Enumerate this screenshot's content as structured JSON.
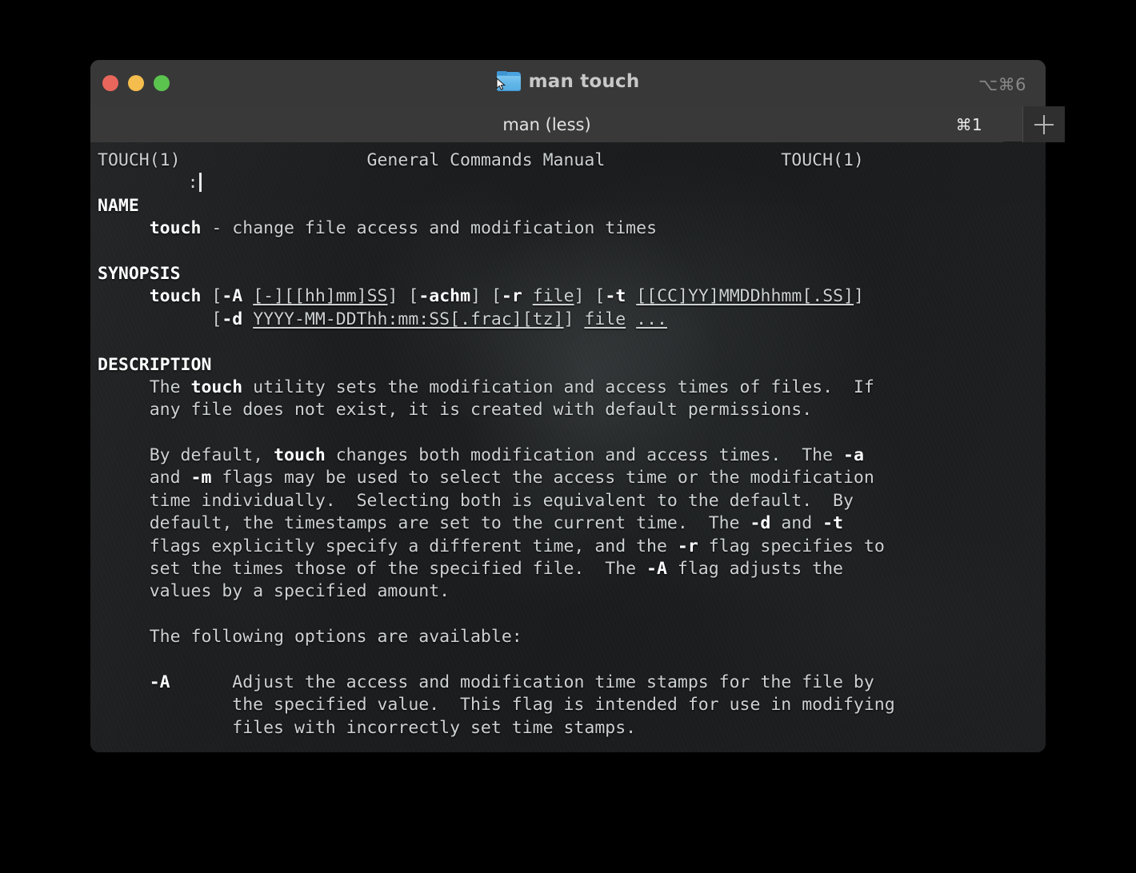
{
  "window": {
    "title": "man touch",
    "title_shortcut": "⌥⌘6",
    "folder_icon": "folder-icon",
    "traffic_lights": {
      "close": "close-button",
      "minimize": "minimize-button",
      "zoom": "zoom-button",
      "close_color": "#e8665c",
      "minimize_color": "#f4bd4d",
      "zoom_color": "#5bc44e"
    }
  },
  "tabbar": {
    "tab_label": "man (less)",
    "tab_shortcut": "⌘1",
    "new_tab_icon": "plus-icon"
  },
  "terminal": {
    "prompt": ":",
    "lines": [
      {
        "id": "l01",
        "segments": [
          {
            "t": "TOUCH(1)                  General Commands Manual                 TOUCH(1)",
            "s": "n"
          }
        ]
      },
      {
        "id": "l02",
        "segments": [
          {
            "t": "",
            "s": "n"
          }
        ]
      },
      {
        "id": "l03",
        "segments": [
          {
            "t": "NAME",
            "s": "b"
          }
        ]
      },
      {
        "id": "l04",
        "segments": [
          {
            "t": "     ",
            "s": "n"
          },
          {
            "t": "touch",
            "s": "b"
          },
          {
            "t": " - change file access and modification times",
            "s": "n"
          }
        ]
      },
      {
        "id": "l05",
        "segments": [
          {
            "t": "",
            "s": "n"
          }
        ]
      },
      {
        "id": "l06",
        "segments": [
          {
            "t": "SYNOPSIS",
            "s": "b"
          }
        ]
      },
      {
        "id": "l07",
        "segments": [
          {
            "t": "     ",
            "s": "n"
          },
          {
            "t": "touch",
            "s": "b"
          },
          {
            "t": " [",
            "s": "n"
          },
          {
            "t": "-A",
            "s": "b"
          },
          {
            "t": " ",
            "s": "n"
          },
          {
            "t": "[-][[hh]mm]SS",
            "s": "u"
          },
          {
            "t": "] [",
            "s": "n"
          },
          {
            "t": "-achm",
            "s": "b"
          },
          {
            "t": "] [",
            "s": "n"
          },
          {
            "t": "-r",
            "s": "b"
          },
          {
            "t": " ",
            "s": "n"
          },
          {
            "t": "file",
            "s": "u"
          },
          {
            "t": "] [",
            "s": "n"
          },
          {
            "t": "-t",
            "s": "b"
          },
          {
            "t": " ",
            "s": "n"
          },
          {
            "t": "[[CC]YY]MMDDhhmm[.SS]",
            "s": "u"
          },
          {
            "t": "]",
            "s": "n"
          }
        ]
      },
      {
        "id": "l08",
        "segments": [
          {
            "t": "           [",
            "s": "n"
          },
          {
            "t": "-d",
            "s": "b"
          },
          {
            "t": " ",
            "s": "n"
          },
          {
            "t": "YYYY-MM-DDThh:mm:SS[.frac][tz]",
            "s": "u"
          },
          {
            "t": "] ",
            "s": "n"
          },
          {
            "t": "file",
            "s": "u"
          },
          {
            "t": " ",
            "s": "n"
          },
          {
            "t": "...",
            "s": "u"
          }
        ]
      },
      {
        "id": "l09",
        "segments": [
          {
            "t": "",
            "s": "n"
          }
        ]
      },
      {
        "id": "l10",
        "segments": [
          {
            "t": "DESCRIPTION",
            "s": "b"
          }
        ]
      },
      {
        "id": "l11",
        "segments": [
          {
            "t": "     The ",
            "s": "n"
          },
          {
            "t": "touch",
            "s": "b"
          },
          {
            "t": " utility sets the modification and access times of files.  If",
            "s": "n"
          }
        ]
      },
      {
        "id": "l12",
        "segments": [
          {
            "t": "     any file does not exist, it is created with default permissions.",
            "s": "n"
          }
        ]
      },
      {
        "id": "l13",
        "segments": [
          {
            "t": "",
            "s": "n"
          }
        ]
      },
      {
        "id": "l14",
        "segments": [
          {
            "t": "     By default, ",
            "s": "n"
          },
          {
            "t": "touch",
            "s": "b"
          },
          {
            "t": " changes both modification and access times.  The ",
            "s": "n"
          },
          {
            "t": "-a",
            "s": "b"
          }
        ]
      },
      {
        "id": "l15",
        "segments": [
          {
            "t": "     and ",
            "s": "n"
          },
          {
            "t": "-m",
            "s": "b"
          },
          {
            "t": " flags may be used to select the access time or the modification",
            "s": "n"
          }
        ]
      },
      {
        "id": "l16",
        "segments": [
          {
            "t": "     time individually.  Selecting both is equivalent to the default.  By",
            "s": "n"
          }
        ]
      },
      {
        "id": "l17",
        "segments": [
          {
            "t": "     default, the timestamps are set to the current time.  The ",
            "s": "n"
          },
          {
            "t": "-d",
            "s": "b"
          },
          {
            "t": " and ",
            "s": "n"
          },
          {
            "t": "-t",
            "s": "b"
          }
        ]
      },
      {
        "id": "l18",
        "segments": [
          {
            "t": "     flags explicitly specify a different time, and the ",
            "s": "n"
          },
          {
            "t": "-r",
            "s": "b"
          },
          {
            "t": " flag specifies to",
            "s": "n"
          }
        ]
      },
      {
        "id": "l19",
        "segments": [
          {
            "t": "     set the times those of the specified file.  The ",
            "s": "n"
          },
          {
            "t": "-A",
            "s": "b"
          },
          {
            "t": " flag adjusts the",
            "s": "n"
          }
        ]
      },
      {
        "id": "l20",
        "segments": [
          {
            "t": "     values by a specified amount.",
            "s": "n"
          }
        ]
      },
      {
        "id": "l21",
        "segments": [
          {
            "t": "",
            "s": "n"
          }
        ]
      },
      {
        "id": "l22",
        "segments": [
          {
            "t": "     The following options are available:",
            "s": "n"
          }
        ]
      },
      {
        "id": "l23",
        "segments": [
          {
            "t": "",
            "s": "n"
          }
        ]
      },
      {
        "id": "l24",
        "segments": [
          {
            "t": "     ",
            "s": "n"
          },
          {
            "t": "-A",
            "s": "b"
          },
          {
            "t": "      Adjust the access and modification time stamps for the file by",
            "s": "n"
          }
        ]
      },
      {
        "id": "l25",
        "segments": [
          {
            "t": "             the specified value.  This flag is intended for use in modifying",
            "s": "n"
          }
        ]
      },
      {
        "id": "l26",
        "segments": [
          {
            "t": "             files with incorrectly set time stamps.",
            "s": "n"
          }
        ]
      }
    ]
  }
}
